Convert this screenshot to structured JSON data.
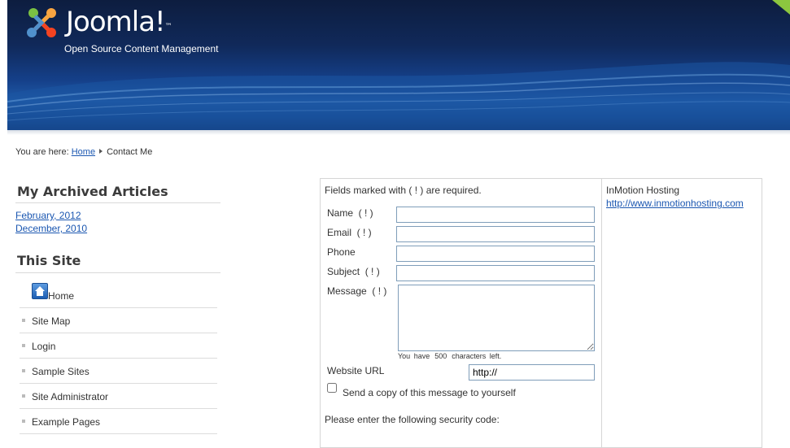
{
  "header": {
    "logo_text": "Joomla!",
    "logo_tm": "™",
    "tagline": "Open Source Content Management"
  },
  "breadcrumb": {
    "prefix": "You are here:",
    "home": "Home",
    "current": "Contact Me"
  },
  "archive": {
    "title": "My Archived Articles",
    "items": [
      "February, 2012",
      "December, 2010"
    ]
  },
  "site_menu": {
    "title": "This Site",
    "items": [
      "Home",
      "Site Map",
      "Login",
      "Sample Sites",
      "Site Administrator",
      "Example Pages"
    ]
  },
  "contact_form": {
    "required_note": "Fields marked with ( ! ) are required.",
    "name_label": "Name  ( ! )",
    "email_label": "Email  ( ! )",
    "phone_label": "Phone",
    "subject_label": "Subject  ( ! )",
    "message_label": "Message  ( ! )",
    "chars_prefix": "You have",
    "chars_count": "500",
    "chars_suffix": "characters left.",
    "website_label": "Website URL",
    "website_value": "http://",
    "copy_label": "Send a copy of this message to yourself",
    "security_prompt": "Please enter the following security code:"
  },
  "sidebar_right": {
    "heading": "InMotion Hosting",
    "link": "http://www.inmotionhosting.com"
  },
  "colors": {
    "link": "#1b57b1",
    "header_dark": "#0d1d3f",
    "header_light": "#1f5ba8"
  }
}
